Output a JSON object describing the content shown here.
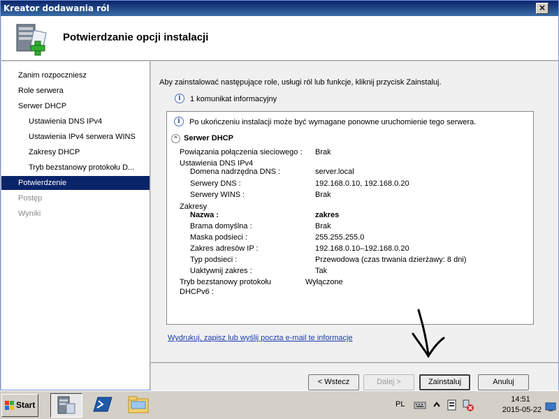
{
  "window": {
    "title": "Kreator dodawania ról",
    "close_glyph": "×"
  },
  "header": {
    "title": "Potwierdzanie opcji instalacji"
  },
  "sidebar": {
    "items": [
      {
        "label": "Zanim rozpoczniesz"
      },
      {
        "label": "Role serwera"
      },
      {
        "label": "Serwer DHCP"
      },
      {
        "label": "Ustawienia DNS IPv4"
      },
      {
        "label": "Ustawienia IPv4 serwera WINS"
      },
      {
        "label": "Zakresy DHCP"
      },
      {
        "label": "Tryb bezstanowy protokołu D..."
      },
      {
        "label": "Potwierdzenie"
      },
      {
        "label": "Postęp"
      },
      {
        "label": "Wyniki"
      }
    ]
  },
  "content": {
    "intro": "Aby zainstalować następujące role, usługi ról lub funkcje, kliknij przycisk Zainstaluj.",
    "info_count": "1 komunikat informacyjny",
    "info_glyph": "i",
    "notice": "Po ukończeniu instalacji może być wymagane ponowne uruchomienie tego serwera.",
    "section_toggle": "^",
    "section_title": "Serwer DHCP",
    "binding_label": "Powiązania połączenia sieciowego :",
    "binding_value": "Brak",
    "dns_settings_label": "Ustawienia DNS IPv4",
    "parent_domain_label": "Domena nadrzędna DNS :",
    "parent_domain_value": "server.local",
    "dns_servers_label": "Serwery DNS :",
    "dns_servers_value": "192.168.0.10, 192.168.0.20",
    "wins_label": "Serwery WINS :",
    "wins_value": "Brak",
    "scopes_label": "Zakresy",
    "name_label": "Nazwa :",
    "name_value": "zakres",
    "gateway_label": "Brama domyślna :",
    "gateway_value": "Brak",
    "mask_label": "Maska podsieci :",
    "mask_value": "255.255.255.0",
    "range_label": "Zakres adresów IP :",
    "range_value": "192.168.0.10–192.168.0.20",
    "subnet_type_label": "Typ podsieci :",
    "subnet_type_value": "Przewodowa (czas trwania dzierżawy: 8 dni)",
    "activate_label": "Uaktywnij zakres :",
    "activate_value": "Tak",
    "stateless_label_1": "Tryb bezstanowy protokołu",
    "stateless_label_2": "DHCPv6 :",
    "stateless_value": "Wyłączone",
    "print_link": "Wydrukuj, zapisz lub wyślij poczta e-mail te informacje"
  },
  "footer": {
    "back": "< Wstecz",
    "next": "Dalej >",
    "install": "Zainstaluj",
    "cancel": "Anuluj"
  },
  "taskbar": {
    "start": "Start",
    "language": "PL",
    "time": "14:51",
    "date": "2015-05-22"
  },
  "colors": {
    "title_bar": "#0a246a",
    "selection": "#0a246a",
    "link": "#1a3cb0"
  }
}
